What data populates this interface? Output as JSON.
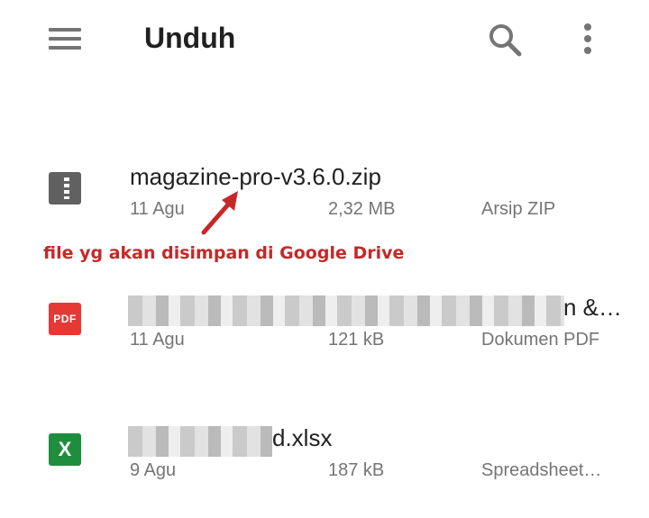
{
  "header": {
    "title": "Unduh",
    "icons": {
      "menu": "hamburger-menu-icon",
      "search": "search-icon",
      "more": "more-vert-icon"
    }
  },
  "files": [
    {
      "name": "magazine-pro-v3.6.0.zip",
      "date": "11 Agu",
      "size": "2,32 MB",
      "type": "Arsip ZIP",
      "icon": "zip-icon",
      "icon_label": ""
    },
    {
      "name": "n &…",
      "date": "11 Agu",
      "size": "121 kB",
      "type": "Dokumen PDF",
      "icon": "pdf-icon",
      "icon_label": "PDF"
    },
    {
      "name": "d.xlsx",
      "date": "9 Agu",
      "size": "187 kB",
      "type": "Spreadsheet…",
      "icon": "excel-icon",
      "icon_label": "X"
    }
  ],
  "annotation": {
    "text": "file yg akan disimpan di Google Drive",
    "color": "#c62828"
  },
  "colors": {
    "zip_icon": "#616161",
    "pdf_icon": "#e53935",
    "xls_icon": "#1e8e3e",
    "secondary_text": "#757575"
  }
}
